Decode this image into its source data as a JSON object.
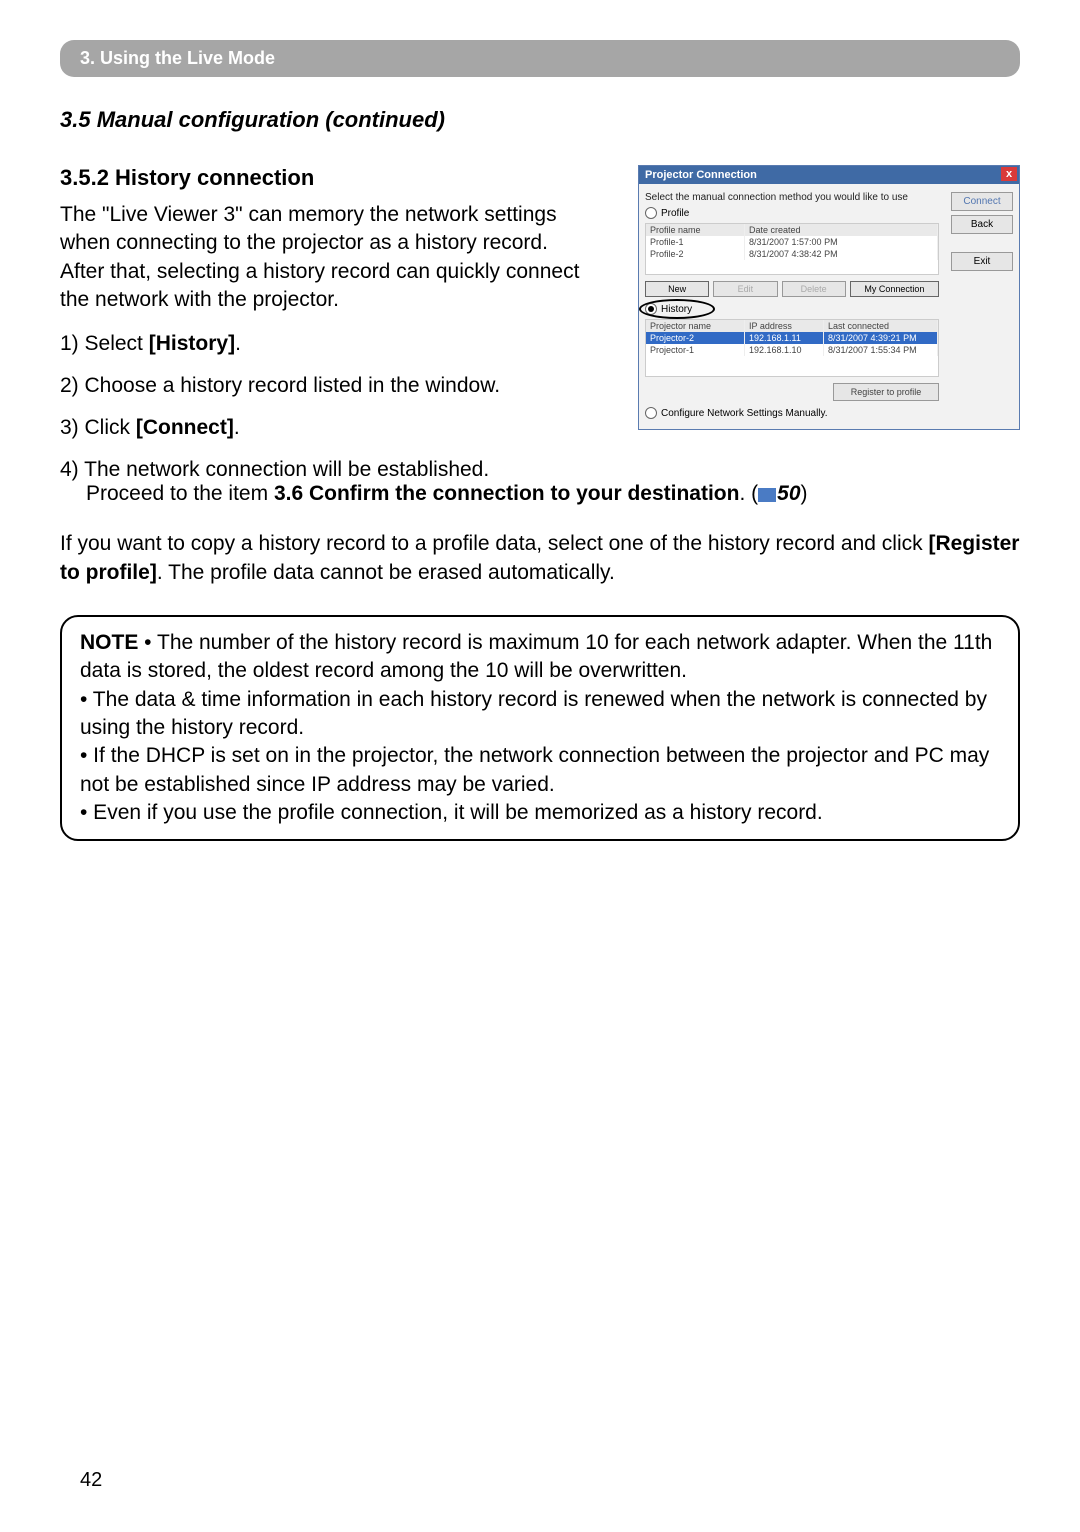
{
  "chapter_bar": "3. Using the Live Mode",
  "section_title": "3.5 Manual configuration (continued)",
  "subsection_title": "3.5.2 History connection",
  "intro_paragraph": "The \"Live Viewer 3\" can memory the network settings when connecting to the projector as a history record. After that, selecting a history record can quickly connect the network with the projector.",
  "steps": {
    "s1_prefix": "1) Select ",
    "s1_bold": "[History]",
    "s1_suffix": ".",
    "s2": "2) Choose a history record listed in the window.",
    "s3_prefix": "3) Click ",
    "s3_bold": "[Connect]",
    "s3_suffix": ".",
    "s4_line1": "4) The network connection will be established.",
    "s4_line2_prefix": "Proceed to the item ",
    "s4_line2_bold": "3.6 Confirm the connection to your destination",
    "s4_line2_suffix": ". (",
    "s4_page": "50",
    "s4_close": ")"
  },
  "copy_paragraph_prefix": "If you want to copy a history record to a profile data, select one of the history record and click ",
  "copy_paragraph_bold": "[Register to profile]",
  "copy_paragraph_suffix": ". The profile data cannot be erased automatically.",
  "note": {
    "label": "NOTE",
    "bullet1": " • The number of the history record is maximum 10 for each network adapter. When the 11th data is stored, the oldest record among the 10 will be overwritten.",
    "bullet2": "• The data & time information in each history record is renewed when the network is connected by using the history record.",
    "bullet3": "• If the DHCP is set on in the projector, the network connection between the projector and PC may not be established since IP address may be varied.",
    "bullet4": "• Even if you use the profile connection, it will be memorized as a history record."
  },
  "page_number": "42",
  "dialog": {
    "title": "Projector Connection",
    "instruction": "Select the manual connection method you would like to use",
    "buttons": {
      "connect": "Connect",
      "back": "Back",
      "exit": "Exit",
      "new": "New",
      "edit": "Edit",
      "delete": "Delete",
      "myconn": "My Connection",
      "register": "Register to profile"
    },
    "radio_profile": "Profile",
    "radio_history": "History",
    "radio_manual": "Configure Network Settings Manually.",
    "profile_table": {
      "cols": [
        "Profile name",
        "Date created"
      ],
      "rows": [
        [
          "Profile-1",
          "8/31/2007 1:57:00 PM"
        ],
        [
          "Profile-2",
          "8/31/2007 4:38:42 PM"
        ]
      ]
    },
    "history_table": {
      "cols": [
        "Projector name",
        "IP address",
        "Last connected"
      ],
      "rows": [
        [
          "Projector-2",
          "192.168.1.11",
          "8/31/2007 4:39:21 PM"
        ],
        [
          "Projector-1",
          "192.168.1.10",
          "8/31/2007 1:55:34 PM"
        ]
      ]
    }
  }
}
